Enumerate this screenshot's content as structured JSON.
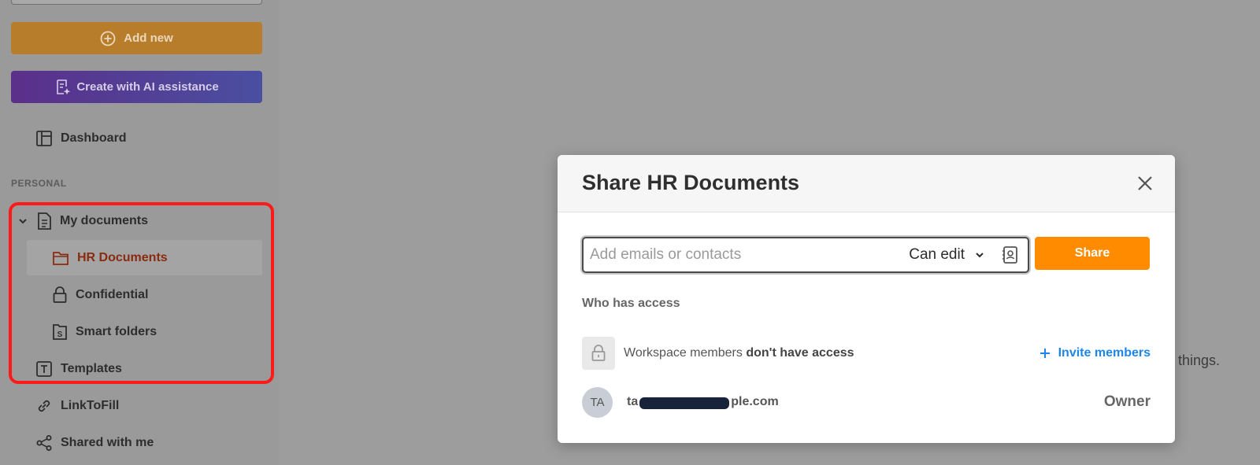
{
  "sidebar": {
    "add_new_label": "Add new",
    "ai_label": "Create with AI assistance",
    "dashboard_label": "Dashboard",
    "section_personal": "PERSONAL",
    "my_documents_label": "My documents",
    "hr_documents_label": "HR Documents",
    "confidential_label": "Confidential",
    "smart_folders_label": "Smart folders",
    "templates_label": "Templates",
    "linktofill_label": "LinkToFill",
    "shared_label": "Shared with me"
  },
  "background": {
    "partial_text": "things."
  },
  "modal": {
    "title": "Share HR Documents",
    "input_placeholder": "Add emails or contacts",
    "permission": "Can edit",
    "share_label": "Share",
    "who_has_access": "Who has access",
    "workspace_text": "Workspace members ",
    "workspace_bold": "don't have access",
    "invite_label": "Invite members",
    "owner_initials": "TA",
    "owner_email_prefix": "ta",
    "owner_email_suffix": "ple.com",
    "owner_role": "Owner"
  },
  "colors": {
    "accent": "#ff8c00",
    "link": "#1e86e8",
    "highlight": "#ff1a1a"
  }
}
